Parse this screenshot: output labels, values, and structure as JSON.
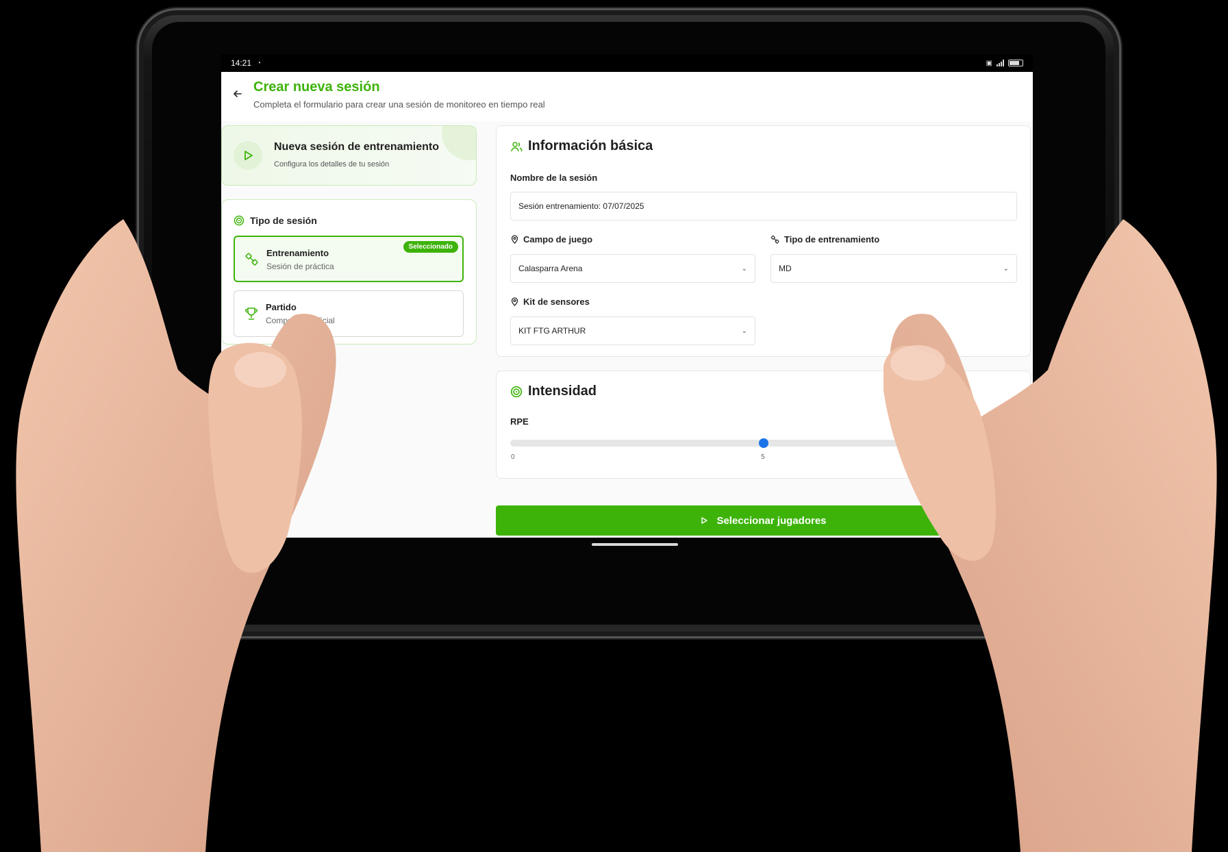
{
  "status_bar": {
    "time": "14:21"
  },
  "header": {
    "title": "Crear nueva sesión",
    "subtitle": "Completa el formulario para crear una sesión de monitoreo en tiempo real"
  },
  "hero": {
    "title": "Nueva sesión de entrenamiento",
    "subtitle": "Configura los detalles de tu sesión"
  },
  "session_type": {
    "title": "Tipo de sesión",
    "options": [
      {
        "title": "Entrenamiento",
        "subtitle": "Sesión de práctica",
        "selected": true,
        "badge": "Seleccionado",
        "icon": "training-icon"
      },
      {
        "title": "Partido",
        "subtitle": "Competición oficial",
        "selected": false,
        "icon": "trophy-icon"
      }
    ]
  },
  "basic_info": {
    "title": "Información básica",
    "session_name_label": "Nombre de la sesión",
    "session_name_value": "Sesión entrenamiento: 07/07/2025",
    "field_label": "Campo de juego",
    "field_value": "Calasparra Arena",
    "training_type_label": "Tipo de entrenamiento",
    "training_type_value": "MD",
    "sensor_kit_label": "Kit de sensores",
    "sensor_kit_value": "KIT FTG ARTHUR"
  },
  "intensity": {
    "title": "Intensidad",
    "rpe_label": "RPE",
    "rpe_value": 5,
    "rpe_fraction": 0.5,
    "tick_min": "0",
    "tick_mid": "5"
  },
  "cta": {
    "label": "Seleccionar jugadores"
  },
  "colors": {
    "accent": "#3db30a",
    "slider": "#1a73e8"
  }
}
